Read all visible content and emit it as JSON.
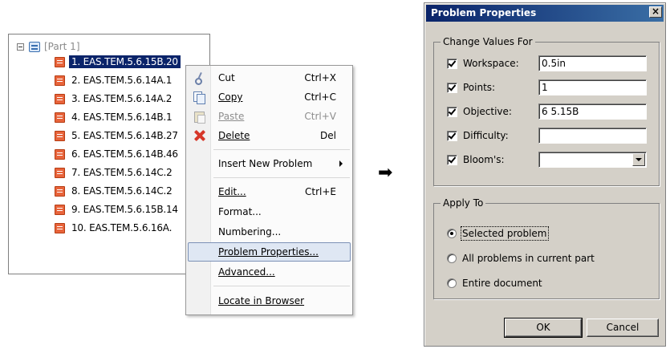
{
  "tree": {
    "part_label": "[Part 1]",
    "items": [
      "1. EAS.TEM.5.6.15B.20",
      "2. EAS.TEM.5.6.14A.1",
      "3. EAS.TEM.5.6.14A.2",
      "4. EAS.TEM.5.6.14B.1",
      "5. EAS.TEM.5.6.14B.27",
      "6. EAS.TEM.5.6.14B.46",
      "7. EAS.TEM.5.6.14C.2",
      "8. EAS.TEM.5.6.14C.2",
      "9. EAS.TEM.5.6.15B.14",
      "10. EAS.TEM.5.6.16A."
    ]
  },
  "context_menu": {
    "cut": {
      "label": "Cut",
      "shortcut": "Ctrl+X"
    },
    "copy": {
      "label": "Copy",
      "shortcut": "Ctrl+C"
    },
    "paste": {
      "label": "Paste",
      "shortcut": "Ctrl+V"
    },
    "delete": {
      "label": "Delete",
      "shortcut": "Del"
    },
    "insert_new_problem": {
      "label": "Insert New Problem"
    },
    "edit": {
      "label": "Edit...",
      "shortcut": "Ctrl+E"
    },
    "format": {
      "label": "Format..."
    },
    "numbering": {
      "label": "Numbering..."
    },
    "problem_properties": {
      "label": "Problem Properties..."
    },
    "advanced": {
      "label": "Advanced..."
    },
    "locate_in_browser": {
      "label": "Locate in Browser"
    }
  },
  "arrow": "➡",
  "dialog": {
    "title": "Problem Properties",
    "close_glyph": "×",
    "change_values_group": "Change Values For",
    "fields": {
      "workspace": {
        "label": "Workspace:",
        "value": "0.5in"
      },
      "points": {
        "label": "Points:",
        "value": "1"
      },
      "objective": {
        "label": "Objective:",
        "value": "6 5.15B"
      },
      "difficulty": {
        "label": "Difficulty:",
        "value": ""
      },
      "blooms": {
        "label": "Bloom's:",
        "value": ""
      }
    },
    "apply_to_group": "Apply To",
    "apply_options": {
      "selected": "Selected problem",
      "all_in_part": "All problems in current part",
      "entire_document": "Entire document"
    },
    "ok_label": "OK",
    "cancel_label": "Cancel"
  }
}
